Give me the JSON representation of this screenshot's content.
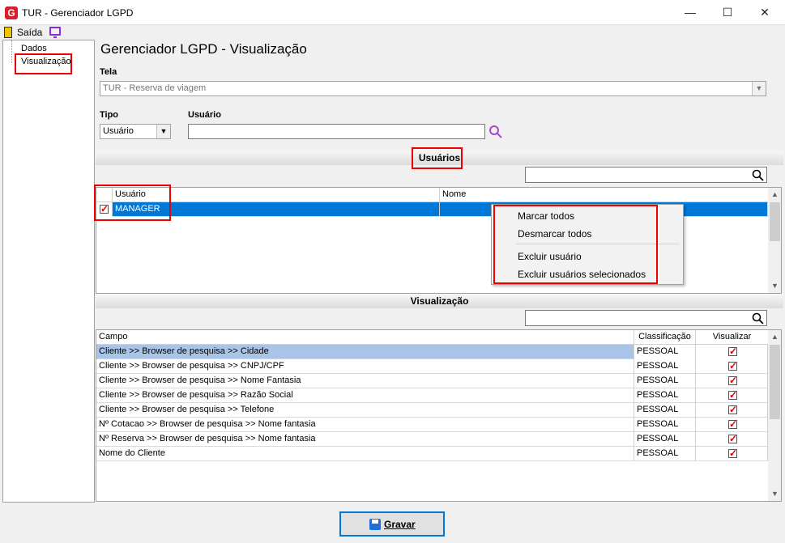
{
  "window": {
    "title": "TUR - Gerenciador LGPD",
    "min": "—",
    "max": "☐",
    "close": "✕"
  },
  "toolbar": {
    "exit_label": "Saída"
  },
  "tree": {
    "items": [
      {
        "label": "Dados"
      },
      {
        "label": "Visualização"
      }
    ]
  },
  "page": {
    "title": "Gerenciador LGPD - Visualização"
  },
  "tela": {
    "label": "Tela",
    "value": "TUR - Reserva de viagem"
  },
  "tipo": {
    "label": "Tipo",
    "value": "Usuário"
  },
  "usuario": {
    "label": "Usuário",
    "value": ""
  },
  "usuarios_section": {
    "title": "Usuários",
    "columns": [
      "Usuário",
      "Nome"
    ],
    "rows": [
      {
        "usuario": "MANAGER",
        "nome": "",
        "checked": true
      }
    ]
  },
  "context_menu": {
    "items": [
      "Marcar todos",
      "Desmarcar todos",
      "Excluir usuário",
      "Excluir usuários selecionados"
    ]
  },
  "visualizacao_section": {
    "title": "Visualização",
    "columns": [
      "Campo",
      "Classificação",
      "Visualizar"
    ],
    "rows": [
      {
        "campo": "Cliente >> Browser de pesquisa >> Cidade",
        "classificacao": "PESSOAL",
        "visualizar": true
      },
      {
        "campo": "Cliente >> Browser de pesquisa >> CNPJ/CPF",
        "classificacao": "PESSOAL",
        "visualizar": true
      },
      {
        "campo": "Cliente >> Browser de pesquisa >> Nome Fantasia",
        "classificacao": "PESSOAL",
        "visualizar": true
      },
      {
        "campo": "Cliente >> Browser de pesquisa >> Razão Social",
        "classificacao": "PESSOAL",
        "visualizar": true
      },
      {
        "campo": "Cliente >> Browser de pesquisa >> Telefone",
        "classificacao": "PESSOAL",
        "visualizar": true
      },
      {
        "campo": "Nº Cotacao >> Browser de pesquisa >> Nome fantasia",
        "classificacao": "PESSOAL",
        "visualizar": true
      },
      {
        "campo": "Nº Reserva >> Browser de pesquisa >> Nome fantasia",
        "classificacao": "PESSOAL",
        "visualizar": true
      },
      {
        "campo": "Nome do Cliente",
        "classificacao": "PESSOAL",
        "visualizar": true
      }
    ]
  },
  "buttons": {
    "save_label": "Gravar"
  },
  "colors": {
    "selection": "#0078d7",
    "row_highlight": "#a9c4e6",
    "annotation": "#e00000",
    "accent": "#8a2be2"
  }
}
